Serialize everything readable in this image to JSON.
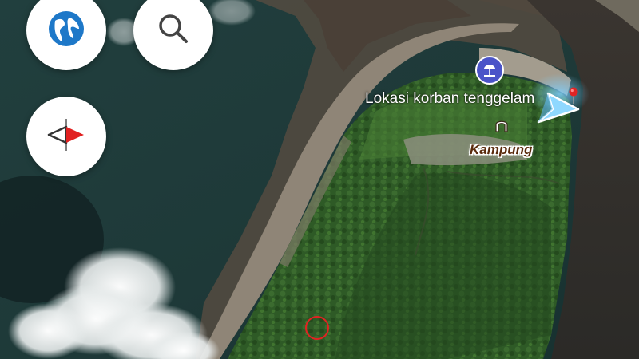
{
  "map": {
    "labels": {
      "victim_location": "Lokasi korban tenggelam",
      "settlement": "Kampung"
    },
    "view": "satellite"
  },
  "controls": {
    "layers_icon": "globe-icon",
    "search_icon": "search-icon",
    "compass_icon": "compass-icon"
  },
  "markers": {
    "resort_poi_icon": "beach-resort-icon",
    "place_poi_icon": "arch-icon",
    "location_pin_icon": "red-pin-icon",
    "target_circle_color": "#e22222",
    "navigation_arrow_icon": "navigation-arrow-icon"
  },
  "colors": {
    "sea": "#1f3d3c",
    "sand": "#8a7f72",
    "forest": "#2f5a26",
    "poi_blue": "#4b54c8",
    "pin_red": "#e02424"
  }
}
